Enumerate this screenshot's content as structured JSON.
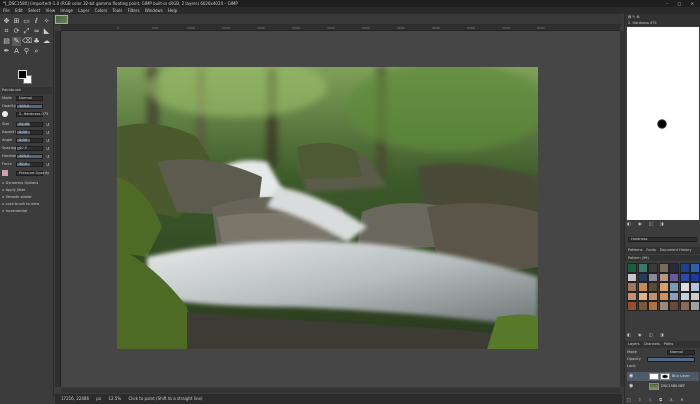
{
  "window": {
    "title": "*[_DSC1580] (imported)-1.0 (RGB color 32-bit gamma floating point, GIMP built-in sRGB, 2 layers) 6026x4024 – GIMP",
    "controls": [
      "–",
      "□",
      "✕"
    ]
  },
  "menubar": [
    "File",
    "Edit",
    "Select",
    "View",
    "Image",
    "Layer",
    "Colors",
    "Tools",
    "Filters",
    "Windows",
    "Help"
  ],
  "tool_options": {
    "title": "Paintbrush",
    "mode_label": "Mode",
    "mode_value": "Normal",
    "opacity_label": "Opacity",
    "opacity_value": "100.0",
    "brush_label": "Brush",
    "brush_value": "2. Hardness 075",
    "rows": [
      {
        "label": "Size",
        "value": "51.00",
        "fill": 0.5
      },
      {
        "label": "Aspect Ratio",
        "value": "0.00",
        "fill": 0.5
      },
      {
        "label": "Angle",
        "value": "0.00",
        "fill": 0.5
      },
      {
        "label": "Spacing",
        "value": "10.0",
        "fill": 0.1
      },
      {
        "label": "Hardness",
        "value": "100.0",
        "fill": 1.0
      },
      {
        "label": "Force",
        "value": "50.0",
        "fill": 0.5
      }
    ],
    "dynamics_label": "Dynamics",
    "dynamics_value": "Pressure Opacity",
    "checks": [
      "Dynamics Options",
      "Apply Jitter",
      "Smooth stroke",
      "Lock brush to view",
      "Incremental"
    ]
  },
  "canvas": {
    "ruler_ticks": [
      "0",
      "500",
      "1000",
      "1500",
      "2000",
      "2500",
      "3000",
      "3500",
      "4000",
      "4500",
      "5000",
      "5500",
      "6000"
    ]
  },
  "status": {
    "unit": "px",
    "zoom": "12.5%",
    "message": "Click to paint (Shift to a straight line)",
    "coords": "17216, 22486"
  },
  "dock": {
    "brush_header": "2. Hardness 075",
    "brush_filter": "Hardness",
    "tabs": [
      "Patterns",
      "Fonts",
      "Document History"
    ],
    "pattern_header": "Pattern (99)",
    "layers_tabs": [
      "Layers",
      "Channels",
      "Paths"
    ],
    "mode_label": "Mode",
    "mode_value": "Normal",
    "opacity_label": "Opacity",
    "lock_label": "Lock:",
    "layers": [
      {
        "name": "Blur Layer",
        "selected": true
      },
      {
        "name": "DSC1580.NEF",
        "selected": false
      }
    ]
  },
  "pattern_colors": [
    "#1b5e3a",
    "#3b7a6d",
    "#3a3a3a",
    "#7a6a5a",
    "#2a2a40",
    "#1f3f8f",
    "#2f5faf",
    "#c8c8c8",
    "#2a3a5a",
    "#8a8a9a",
    "#b89888",
    "#6a5a9a",
    "#2a4aaf",
    "#1a3a9f",
    "#a07860",
    "#c48b5b",
    "#5a4a3a",
    "#d8a070",
    "#7a9ab8",
    "#ddd",
    "#b0c0d8",
    "#c89070",
    "#e0b090",
    "#c09070",
    "#d09060",
    "#8aa0c0",
    "#c0d0e0",
    "#ccc",
    "#905030",
    "#7a5a3a",
    "#b07040",
    "#9a8a7a",
    "#6a4a3a",
    "#8a6a5a",
    "#a0a0a0"
  ]
}
